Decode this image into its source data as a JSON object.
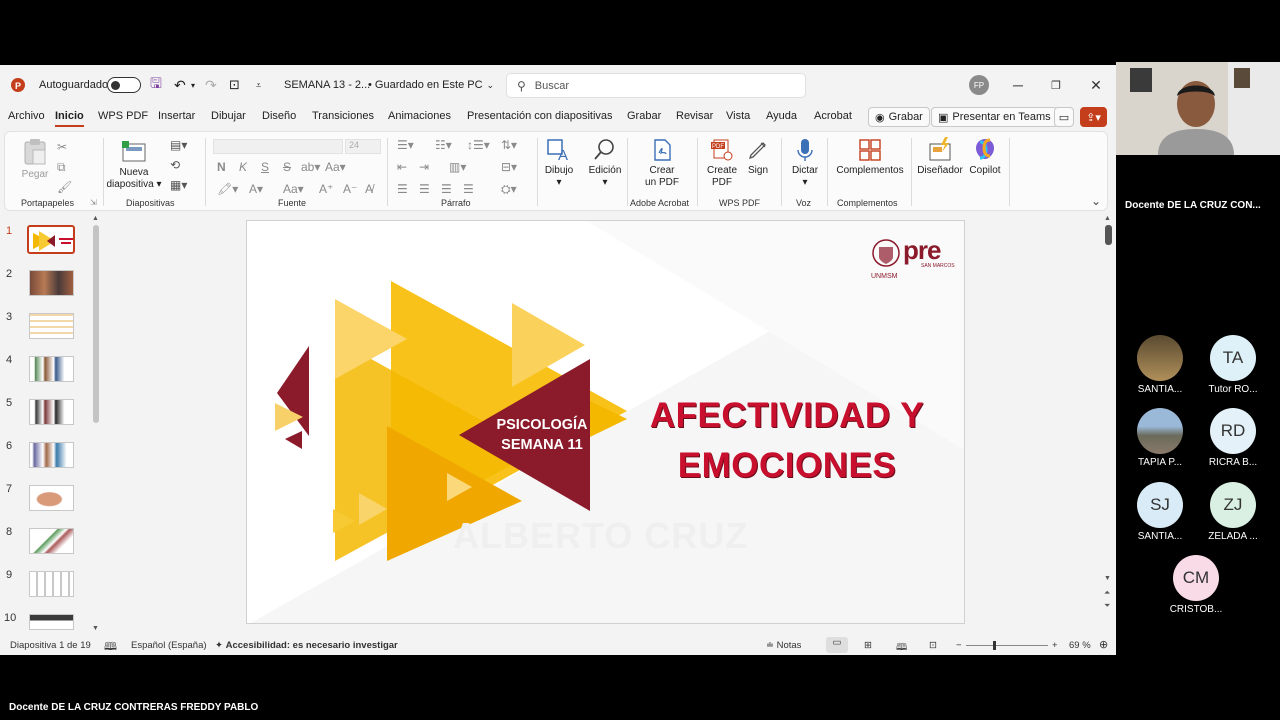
{
  "titlebar": {
    "autosave_label": "Autoguardado",
    "doc_title": "SEMANA 13 -  2...",
    "save_status": "• Guardado en Este PC",
    "search_placeholder": "Buscar",
    "user_initials": "FP"
  },
  "menu": {
    "tabs": [
      "Archivo",
      "Inicio",
      "WPS PDF",
      "Insertar",
      "Dibujar",
      "Diseño",
      "Transiciones",
      "Animaciones",
      "Presentación con diapositivas",
      "Grabar",
      "Revisar",
      "Vista",
      "Ayuda",
      "Acrobat"
    ],
    "active_tab": "Inicio",
    "record_button": "Grabar",
    "teams_button": "Presentar en Teams"
  },
  "ribbon": {
    "groups": {
      "clipboard": "Portapapeles",
      "slides": "Diapositivas",
      "font": "Fuente",
      "paragraph": "Párrafo",
      "adobe": "Adobe Acrobat",
      "wps": "WPS PDF",
      "voice": "Voz",
      "addins": "Complementos"
    },
    "paste_label": "Pegar",
    "new_slide_line1": "Nueva",
    "new_slide_line2": "diapositiva",
    "font_size": "24",
    "draw_label": "Dibujo",
    "edit_label": "Edición",
    "create_pdf_line1": "Crear",
    "create_pdf_line2": "un PDF",
    "wps_create_line1": "Create",
    "wps_create_line2": "PDF",
    "sign_label": "Sign",
    "dictate_label": "Dictar",
    "addins_label": "Complementos",
    "designer_label": "Diseñador",
    "copilot_label": "Copilot",
    "bold": "N",
    "italic": "K",
    "underline": "S",
    "strike": "S"
  },
  "thumbnails": [
    "1",
    "2",
    "3",
    "4",
    "5",
    "6",
    "7",
    "8",
    "9",
    "10"
  ],
  "slide": {
    "badge_line1": "PSICOLOGÍA",
    "badge_line2": "SEMANA 11",
    "title_line1": "AFECTIVIDAD Y",
    "title_line2": "EMOCIONES",
    "watermark": "ALBERTO CRUZ",
    "logo_text": "pre",
    "logo_sub": "SAN MARCOS",
    "logo_org": "UNMSM",
    "colors": {
      "yellow": "#f5b800",
      "maroon": "#8b1a2b",
      "title_red": "#c8102e"
    }
  },
  "status": {
    "slide_count": "Diapositiva 1 de 19",
    "language": "Español (España)",
    "accessibility": "Accesibilidad: es necesario investigar",
    "notes": "Notas",
    "zoom": "69 %"
  },
  "teams": {
    "presenter_name": "Docente DE LA CRUZ CON...",
    "participants": [
      {
        "initials": "",
        "name": "SANTIA...",
        "color": "#6b5a3a"
      },
      {
        "initials": "TA",
        "name": "Tutor RO...",
        "color": "#dff1f8"
      },
      {
        "initials": "",
        "name": "TAPIA P...",
        "color": "#8ab0cc"
      },
      {
        "initials": "RD",
        "name": "RICRA B...",
        "color": "#e4f1f8"
      },
      {
        "initials": "SJ",
        "name": "SANTIA...",
        "color": "#d8ebf6"
      },
      {
        "initials": "ZJ",
        "name": "ZELADA ...",
        "color": "#d9f0e2"
      },
      {
        "initials": "CM",
        "name": "CRISTOB...",
        "color": "#f8dbe6"
      }
    ],
    "bottom_name": "Docente DE LA CRUZ CONTRERAS FREDDY PABLO"
  }
}
